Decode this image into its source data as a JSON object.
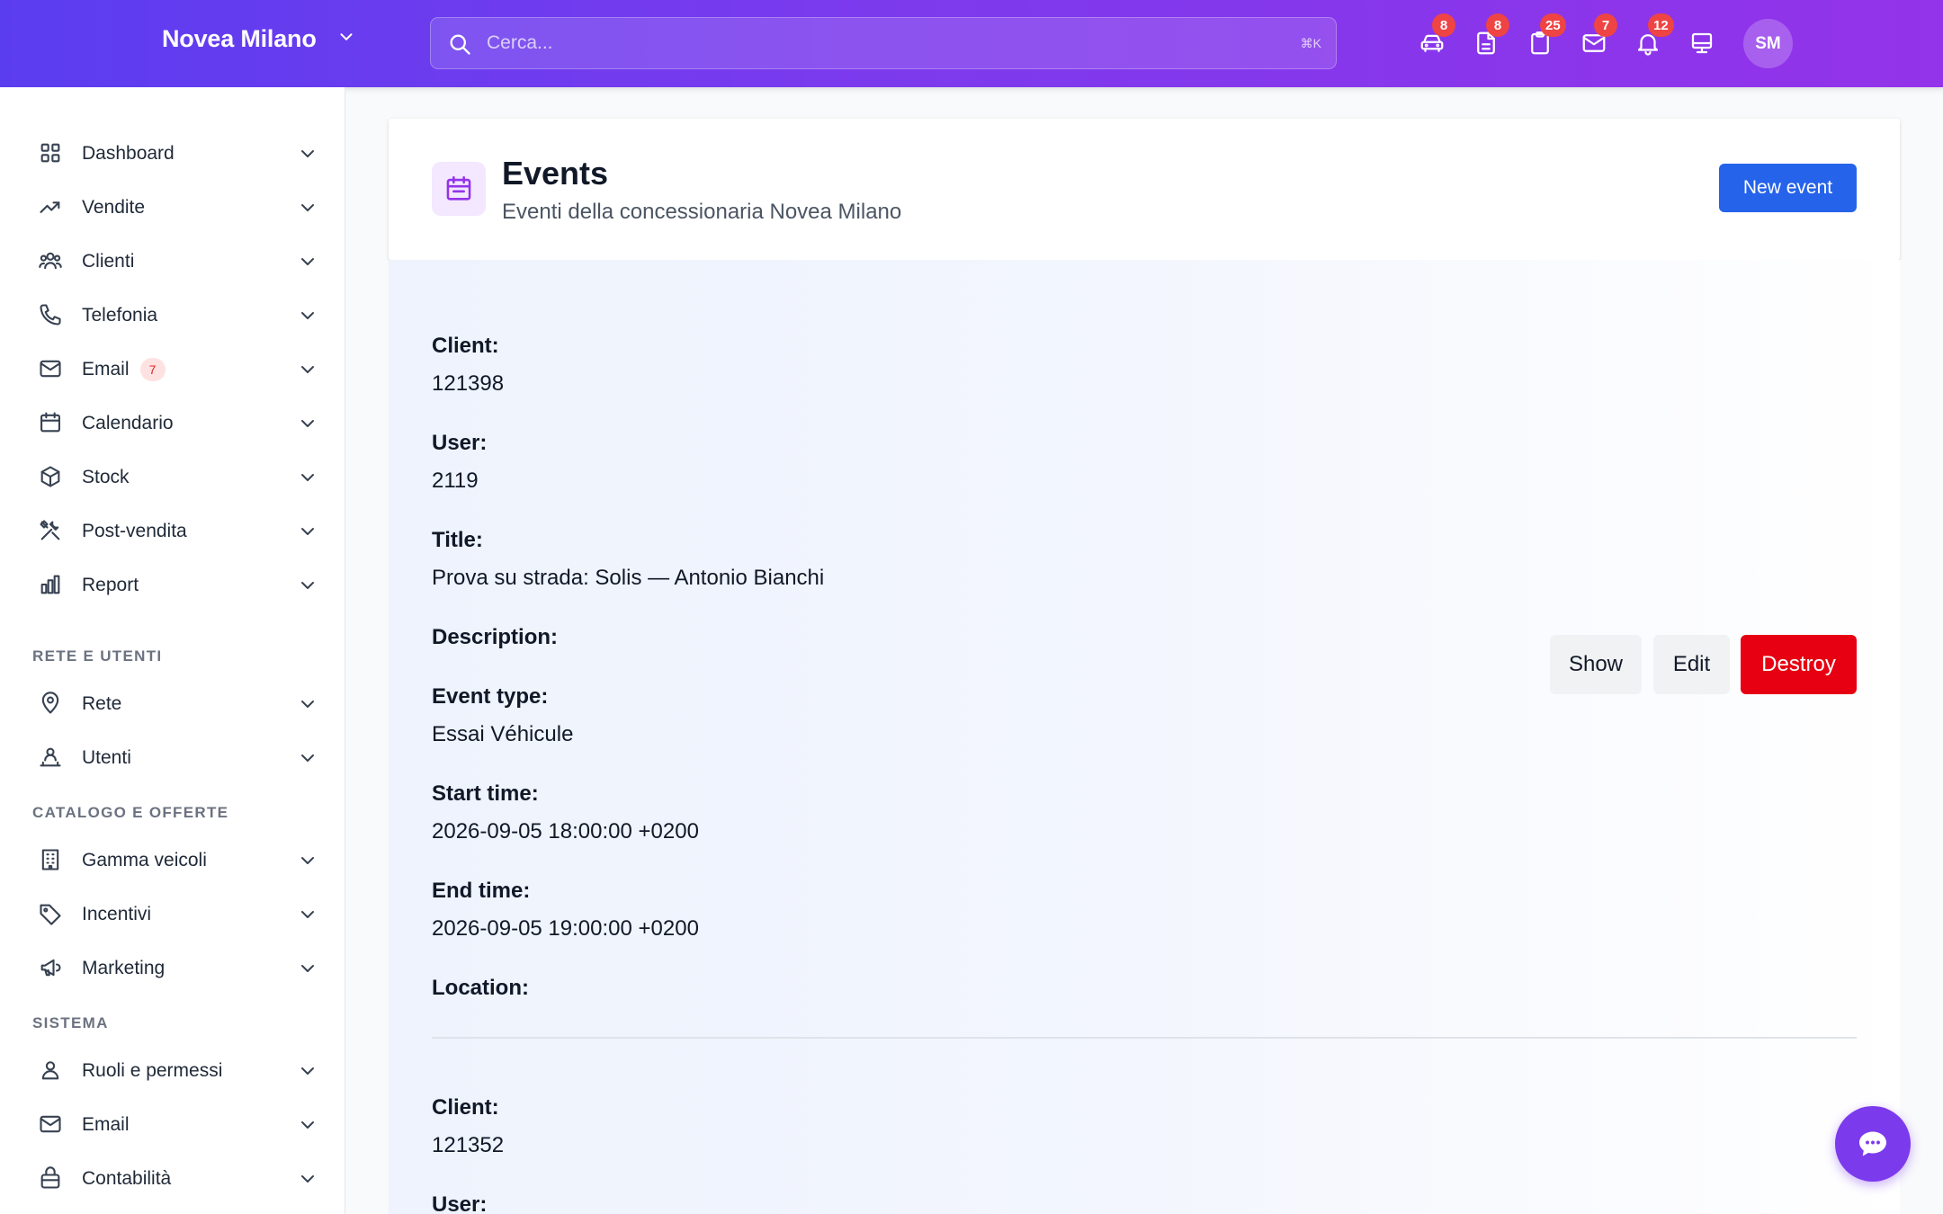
{
  "topbar": {
    "brand": "Novea Milano",
    "search_placeholder": "Cerca...",
    "search_shortcut": "⌘K",
    "badges": {
      "cars": "8",
      "documents": "8",
      "clipboard": "25",
      "mail": "7",
      "notifications": "12"
    },
    "avatar_initials": "SM",
    "accent_gradient": [
      "#5b3df0",
      "#9333ea"
    ]
  },
  "sidebar": {
    "main_items": [
      {
        "label": "Dashboard",
        "icon": "grid-icon"
      },
      {
        "label": "Vendite",
        "icon": "trending-up-icon"
      },
      {
        "label": "Clienti",
        "icon": "users-icon"
      },
      {
        "label": "Telefonia",
        "icon": "phone-icon"
      },
      {
        "label": "Email",
        "icon": "mail-icon",
        "badge": "7"
      },
      {
        "label": "Calendario",
        "icon": "calendar-icon"
      },
      {
        "label": "Stock",
        "icon": "cube-icon"
      },
      {
        "label": "Post-vendita",
        "icon": "tools-icon"
      },
      {
        "label": "Report",
        "icon": "bar-chart-icon"
      }
    ],
    "section_network": "RETE E UTENTI",
    "network_items": [
      {
        "label": "Rete",
        "icon": "map-pin-icon"
      },
      {
        "label": "Utenti",
        "icon": "user-group-icon"
      }
    ],
    "section_catalog": "CATALOGO E OFFERTE",
    "catalog_items": [
      {
        "label": "Gamma veicoli",
        "icon": "building-icon"
      },
      {
        "label": "Incentivi",
        "icon": "tag-icon"
      },
      {
        "label": "Marketing",
        "icon": "megaphone-icon"
      }
    ],
    "section_system": "SISTEMA",
    "system_items": [
      {
        "label": "Ruoli e permessi",
        "icon": "user-icon"
      },
      {
        "label": "Email",
        "icon": "mail-icon"
      },
      {
        "label": "Contabilità",
        "icon": "lock-bag-icon"
      }
    ]
  },
  "header": {
    "title": "Events",
    "subtitle": "Eventi della concessionaria Novea Milano",
    "new_button": "New event"
  },
  "labels": {
    "client": "Client:",
    "user": "User:",
    "title": "Title:",
    "description": "Description:",
    "event_type": "Event type:",
    "start_time": "Start time:",
    "end_time": "End time:",
    "location": "Location:"
  },
  "actions": {
    "show": "Show",
    "edit": "Edit",
    "destroy": "Destroy"
  },
  "events": [
    {
      "client": "121398",
      "user": "2119",
      "title": "Prova su strada: Solis — Antonio Bianchi",
      "description": "",
      "event_type": "Essai Véhicule",
      "start_time": "2026-09-05 18:00:00 +0200",
      "end_time": "2026-09-05 19:00:00 +0200",
      "location": ""
    },
    {
      "client": "121352"
    }
  ]
}
